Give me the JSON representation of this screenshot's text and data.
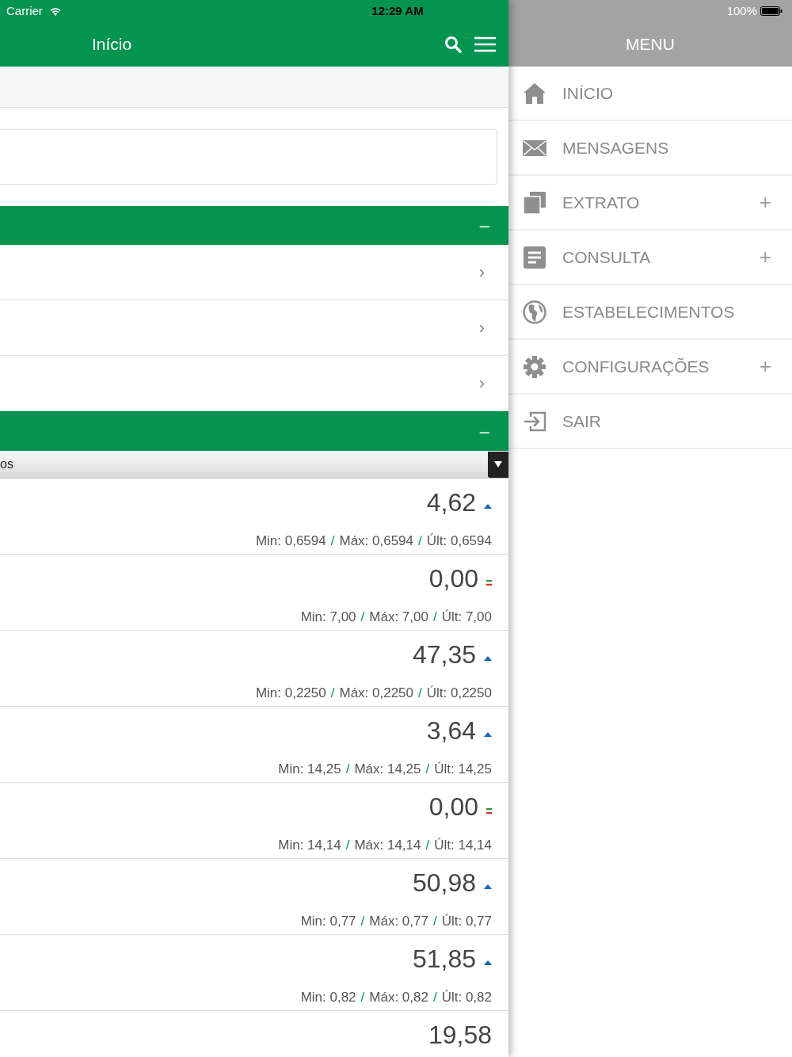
{
  "status_bar": {
    "carrier": "Carrier",
    "time": "12:29 AM",
    "battery": "100%"
  },
  "header": {
    "title": "Início"
  },
  "menu": {
    "title": "MENU",
    "items": [
      {
        "kind": "house",
        "label": "INÍCIO"
      },
      {
        "kind": "envelope",
        "label": "MENSAGENS"
      },
      {
        "kind": "pages",
        "label": "EXTRATO",
        "expander": "+"
      },
      {
        "kind": "document",
        "label": "CONSULTA",
        "expander": "+"
      },
      {
        "kind": "globe",
        "label": "ESTABELECIMENTOS"
      },
      {
        "kind": "gear",
        "label": "CONFIGURAÇÕES",
        "expander": "+"
      },
      {
        "kind": "exit",
        "label": "SAIR"
      }
    ]
  },
  "section_1": {
    "toggle": "–",
    "rows": [
      {
        "chevron": "›"
      },
      {
        "chevron": "›"
      },
      {
        "chevron": "›"
      }
    ]
  },
  "section_2": {
    "toggle": "–",
    "select_value": "os"
  },
  "quotes": [
    {
      "value": "4,62",
      "kind": "up",
      "stats": [
        "Min: 0,6594",
        "Máx: 0,6594",
        "Últ: 0,6594"
      ],
      "separators": [
        "/",
        "/"
      ]
    },
    {
      "value": "0,00",
      "kind": "flat",
      "stats": [
        "Min: 7,00",
        "Máx: 7,00",
        "Últ: 7,00"
      ],
      "separators": [
        "/",
        "/"
      ]
    },
    {
      "value": "47,35",
      "kind": "up",
      "stats": [
        "Min: 0,2250",
        "Máx: 0,2250",
        "Últ: 0,2250"
      ],
      "separators": [
        "/",
        "/"
      ]
    },
    {
      "value": "3,64",
      "kind": "up",
      "stats": [
        "Min: 14,25",
        "Máx: 14,25",
        "Últ: 14,25"
      ],
      "separators": [
        "/",
        "/"
      ]
    },
    {
      "value": "0,00",
      "kind": "flat",
      "stats": [
        "Min: 14,14",
        "Máx: 14,14",
        "Últ: 14,14"
      ],
      "separators": [
        "/",
        "/"
      ]
    },
    {
      "value": "50,98",
      "kind": "up",
      "stats": [
        "Min: 0,77",
        "Máx: 0,77",
        "Últ: 0,77"
      ],
      "separators": [
        "/",
        "/"
      ]
    },
    {
      "value": "51,85",
      "kind": "up",
      "stats": [
        "Min: 0,82",
        "Máx: 0,82",
        "Últ: 0,82"
      ],
      "separators": [
        "/",
        "/"
      ]
    },
    {
      "value": "19,58"
    }
  ]
}
